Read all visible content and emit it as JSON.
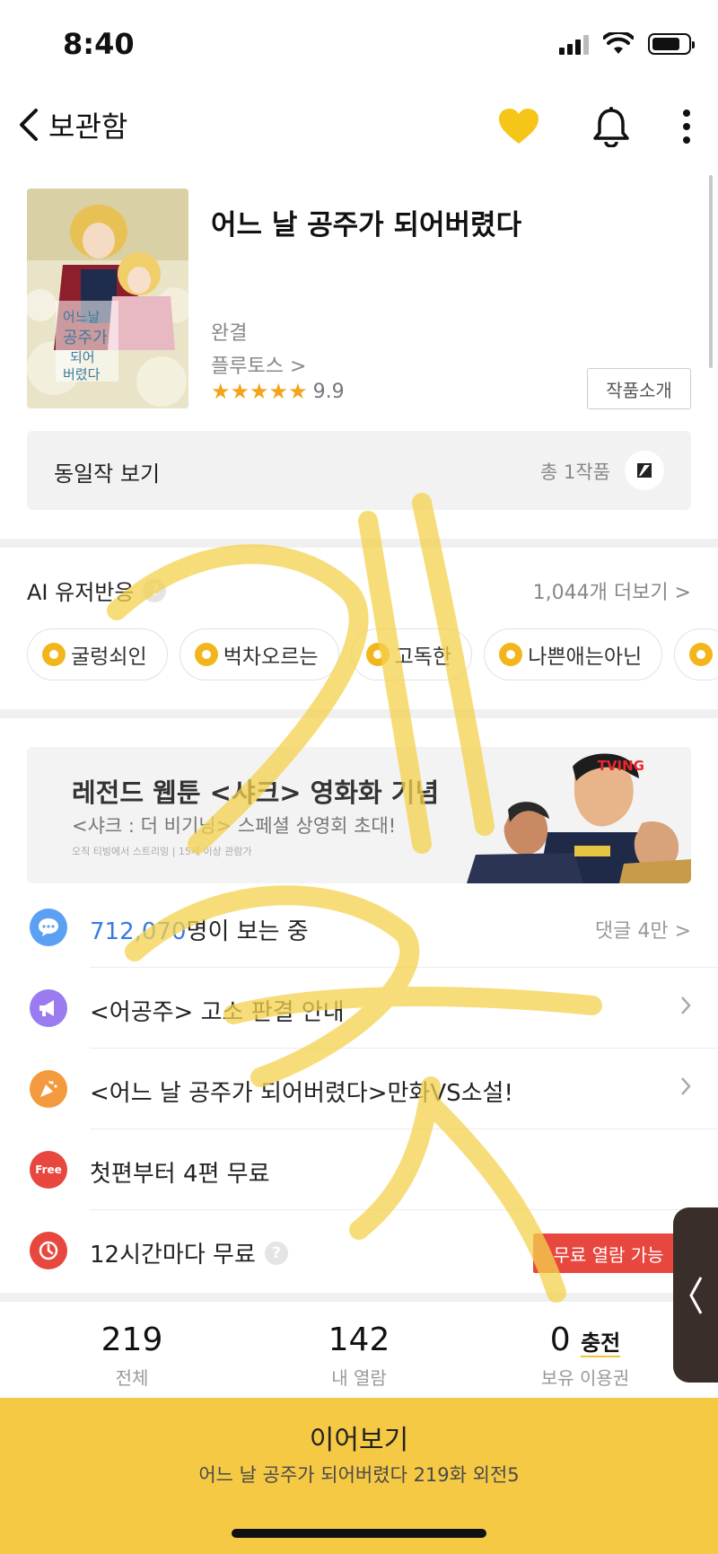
{
  "status_bar": {
    "time": "8:40"
  },
  "nav": {
    "back_label": "보관함"
  },
  "book": {
    "title": "어느 날 공주가 되어버렸다",
    "status": "완결",
    "author": "플루토스 >",
    "stars": "★★★★★",
    "rating": "9.9",
    "intro_button": "작품소개",
    "cover_text": "어느날 공주가 되어 버렸다"
  },
  "same_works": {
    "label": "동일작 보기",
    "count": "총 1작품"
  },
  "ai_reactions": {
    "title": "AI 유저반응",
    "help": "?",
    "more": "1,044개 더보기 >",
    "chips": [
      "굴렁쇠인",
      "벅차오르는",
      "고독한",
      "나쁜애는아닌"
    ]
  },
  "banner": {
    "title": "레전드 웹툰 <샤크> 영화화 기념",
    "subtitle": "<샤크 : 더 비기닝> 스페셜 상영회 초대!",
    "note": "오직 티빙에서 스트리밍 | 15세 이상 관람가",
    "brand": "TVING"
  },
  "info_rows": {
    "viewers_count": "712,070",
    "viewers_suffix": "명이 보는 중",
    "comments": "댓글 4만 >",
    "notice": "<어공주> 고소 판결 안내",
    "event": "<어느 날 공주가 되어버렸다>만화VS소설!",
    "free_label": "Free",
    "free_episodes": "첫편부터 4편 무료",
    "wait_free": "12시간마다 무료",
    "wait_free_badge": "무료 열람 가능"
  },
  "counts": {
    "total_num": "219",
    "total_label": "전체",
    "read_num": "142",
    "read_label": "내 열람",
    "tickets_num": "0",
    "charge_label": "충전",
    "tickets_label": "보유 이용권"
  },
  "cta": {
    "title": "이어보기",
    "subtitle": "어느 날 공주가 되어버렸다 219화 외전5"
  },
  "colors": {
    "accent_yellow": "#f6c944",
    "heart": "#f5c518",
    "free_red": "#e8473f",
    "link_blue": "#3b7be0",
    "star": "#f3a41c"
  }
}
